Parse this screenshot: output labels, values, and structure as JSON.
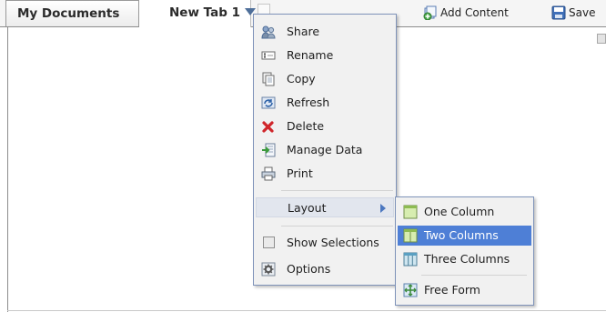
{
  "tabs": {
    "my_documents": "My Documents",
    "new_tab": "New Tab 1"
  },
  "toolbar": {
    "add_content": "Add Content",
    "save": "Save"
  },
  "context_menu": {
    "items": {
      "share": "Share",
      "rename": "Rename",
      "copy": "Copy",
      "refresh": "Refresh",
      "delete": "Delete",
      "manage_data": "Manage Data",
      "print": "Print",
      "layout": "Layout",
      "show_selections": "Show Selections",
      "options": "Options"
    },
    "show_selections_checked": false
  },
  "layout_submenu": {
    "items": {
      "one_column": "One Column",
      "two_columns": "Two Columns",
      "three_columns": "Three Columns",
      "free_form": "Free Form"
    },
    "selected": "two_columns"
  },
  "colors": {
    "selection": "#4e7fd6",
    "menu_border": "#7f93b9",
    "tab_arrow": "#4f6f9a"
  },
  "icons": {
    "share": "share-icon",
    "rename": "rename-icon",
    "copy": "copy-icon",
    "refresh": "refresh-icon",
    "delete": "delete-icon",
    "manage_data": "manage-data-icon",
    "print": "print-icon",
    "options": "options-icon",
    "add_content": "add-content-icon",
    "save": "save-icon"
  }
}
